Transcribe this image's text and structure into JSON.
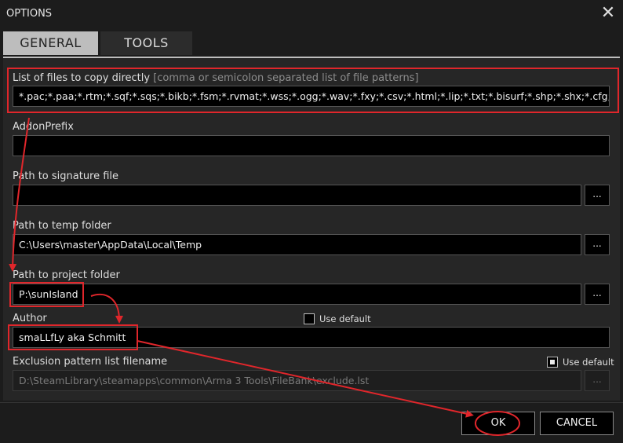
{
  "window": {
    "title": "OPTIONS"
  },
  "tabs": [
    {
      "label": "GENERAL"
    },
    {
      "label": "TOOLS"
    }
  ],
  "fields": {
    "files_to_copy": {
      "label": "List of files to copy directly",
      "hint": "[comma or semicolon separated list of file patterns]",
      "value": "*.pac;*.paa;*.rtm;*.sqf;*.sqs;*.bikb;*.fsm;*.rvmat;*.wss;*.ogg;*.wav;*.fxy;*.csv;*.html;*.lip;*.txt;*.bisurf;*.shp;*.shx;*.cfg;*.dbf"
    },
    "addon_prefix": {
      "label": "AddonPrefix",
      "value": ""
    },
    "signature_file": {
      "label": "Path to signature file",
      "value": "",
      "browse": "..."
    },
    "temp_folder": {
      "label": "Path to temp folder",
      "value": "C:\\Users\\master\\AppData\\Local\\Temp",
      "browse": "..."
    },
    "project_folder": {
      "label": "Path to project folder",
      "value": "P:\\sunIsland",
      "browse": "..."
    },
    "author": {
      "label": "Author",
      "value": "smaLLfLy aka Schmitt",
      "use_default_label": "Use default",
      "use_default_checked": false
    },
    "exclusion": {
      "label": "Exclusion pattern list filename",
      "value": "D:\\SteamLibrary\\steamapps\\common\\Arma 3 Tools\\FileBank\\exclude.lst",
      "browse": "...",
      "use_default_label": "Use default",
      "use_default_checked": true
    }
  },
  "buttons": {
    "ok": "OK",
    "cancel": "CANCEL"
  },
  "colors": {
    "annotation": "#e0262b",
    "tab_active_bg": "#bdbdbd",
    "field_bg": "#000000"
  },
  "icons": {
    "close": "close-icon",
    "checkbox_checked": "checkbox-checked-icon",
    "checkbox_unchecked": "checkbox-unchecked-icon"
  }
}
